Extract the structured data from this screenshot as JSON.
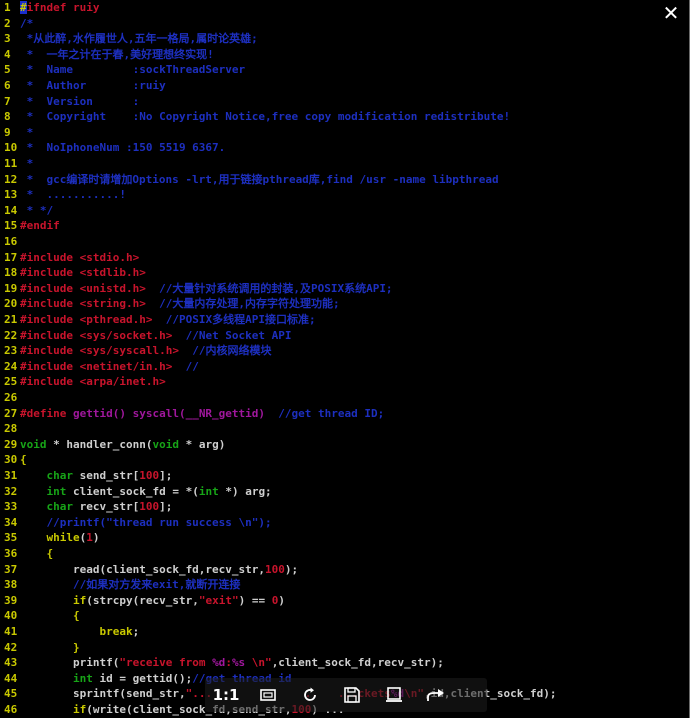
{
  "viewer": {
    "close_glyph": "✕",
    "toolbar": {
      "actual_size_label": "1:1",
      "buttons": [
        "actual-size",
        "fit-window",
        "rotate",
        "save",
        "download",
        "share"
      ]
    }
  },
  "code": {
    "lines": [
      {
        "n": "1",
        "spans": [
          [
            "cursor",
            "#"
          ],
          [
            "c-pre",
            "ifndef ruiy"
          ]
        ]
      },
      {
        "n": "2",
        "spans": [
          [
            "c-cmt",
            "/*"
          ]
        ]
      },
      {
        "n": "3",
        "spans": [
          [
            "c-cmt",
            " *从此醉,水作履世人,五年一格局,属时论英雄;"
          ]
        ]
      },
      {
        "n": "4",
        "spans": [
          [
            "c-cmt",
            " *  一年之计在于春,美好理想终实现!"
          ]
        ]
      },
      {
        "n": "5",
        "spans": [
          [
            "c-cmt",
            " *  Name         :sockThreadServer"
          ]
        ]
      },
      {
        "n": "6",
        "spans": [
          [
            "c-cmt",
            " *  Author       :ruiy"
          ]
        ]
      },
      {
        "n": "7",
        "spans": [
          [
            "c-cmt",
            " *  Version      :"
          ]
        ]
      },
      {
        "n": "8",
        "spans": [
          [
            "c-cmt",
            " *  Copyright    :No Copyright Notice,free copy modification redistribute!"
          ]
        ]
      },
      {
        "n": "9",
        "spans": [
          [
            "c-cmt",
            " *"
          ]
        ]
      },
      {
        "n": "10",
        "spans": [
          [
            "c-cmt",
            " *  NoIphoneNum :150 5519 6367."
          ]
        ]
      },
      {
        "n": "11",
        "spans": [
          [
            "c-cmt",
            " *"
          ]
        ]
      },
      {
        "n": "12",
        "spans": [
          [
            "c-cmt",
            " *  gcc编译时请增加Options -lrt,用于链接pthread库,find /usr -name libpthread"
          ]
        ]
      },
      {
        "n": "13",
        "spans": [
          [
            "c-cmt",
            " *  ...........!"
          ]
        ]
      },
      {
        "n": "14",
        "spans": [
          [
            "c-cmt",
            " * */"
          ]
        ]
      },
      {
        "n": "15",
        "spans": [
          [
            "c-pre",
            "#endif"
          ]
        ]
      },
      {
        "n": "16",
        "spans": []
      },
      {
        "n": "17",
        "spans": [
          [
            "c-pre",
            "#include "
          ],
          [
            "c-inc",
            "<stdio.h>"
          ]
        ]
      },
      {
        "n": "18",
        "spans": [
          [
            "c-pre",
            "#include "
          ],
          [
            "c-inc",
            "<stdlib.h>"
          ]
        ]
      },
      {
        "n": "19",
        "spans": [
          [
            "c-pre",
            "#include "
          ],
          [
            "c-inc",
            "<unistd.h>"
          ],
          [
            "c-cmt",
            "  //大量针对系统调用的封装,及POSIX系统API;"
          ]
        ]
      },
      {
        "n": "20",
        "spans": [
          [
            "c-pre",
            "#include "
          ],
          [
            "c-inc",
            "<string.h>"
          ],
          [
            "c-cmt",
            "  //大量内存处理,内存字符处理功能;"
          ]
        ]
      },
      {
        "n": "21",
        "spans": [
          [
            "c-pre",
            "#include "
          ],
          [
            "c-inc",
            "<pthread.h>"
          ],
          [
            "c-cmt",
            "  //POSIX多线程API接口标准;"
          ]
        ]
      },
      {
        "n": "22",
        "spans": [
          [
            "c-pre",
            "#include "
          ],
          [
            "c-inc",
            "<sys/socket.h>"
          ],
          [
            "c-cmt",
            "  //Net Socket API"
          ]
        ]
      },
      {
        "n": "23",
        "spans": [
          [
            "c-pre",
            "#include "
          ],
          [
            "c-inc",
            "<sys/syscall.h>"
          ],
          [
            "c-cmt",
            "  //内核网络模块"
          ]
        ]
      },
      {
        "n": "24",
        "spans": [
          [
            "c-pre",
            "#include "
          ],
          [
            "c-inc",
            "<netinet/in.h>"
          ],
          [
            "c-cmt",
            "  //"
          ]
        ]
      },
      {
        "n": "25",
        "spans": [
          [
            "c-pre",
            "#include "
          ],
          [
            "c-inc",
            "<arpa/inet.h>"
          ]
        ]
      },
      {
        "n": "26",
        "spans": []
      },
      {
        "n": "27",
        "spans": [
          [
            "c-pre",
            "#define "
          ],
          [
            "c-def",
            "gettid() syscall(__NR_gettid)"
          ],
          [
            "c-cmt",
            "  //get thread ID;"
          ]
        ]
      },
      {
        "n": "28",
        "spans": []
      },
      {
        "n": "29",
        "spans": [
          [
            "c-type",
            "void"
          ],
          [
            "c-txt",
            " * handler_conn("
          ],
          [
            "c-type",
            "void"
          ],
          [
            "c-txt",
            " * arg)"
          ]
        ]
      },
      {
        "n": "30",
        "spans": [
          [
            "c-kw",
            "{"
          ]
        ]
      },
      {
        "n": "31",
        "spans": [
          [
            "c-txt",
            "    "
          ],
          [
            "c-type",
            "char"
          ],
          [
            "c-txt",
            " send_str["
          ],
          [
            "c-num",
            "100"
          ],
          [
            "c-txt",
            "];"
          ]
        ]
      },
      {
        "n": "32",
        "spans": [
          [
            "c-txt",
            "    "
          ],
          [
            "c-type",
            "int"
          ],
          [
            "c-txt",
            " client_sock_fd = *("
          ],
          [
            "c-type",
            "int"
          ],
          [
            "c-txt",
            " *) arg;"
          ]
        ]
      },
      {
        "n": "33",
        "spans": [
          [
            "c-txt",
            "    "
          ],
          [
            "c-type",
            "char"
          ],
          [
            "c-txt",
            " recv_str["
          ],
          [
            "c-num",
            "100"
          ],
          [
            "c-txt",
            "];"
          ]
        ]
      },
      {
        "n": "34",
        "spans": [
          [
            "c-cmt",
            "    //printf(\"thread run success \\n\");"
          ]
        ]
      },
      {
        "n": "35",
        "spans": [
          [
            "c-txt",
            "    "
          ],
          [
            "c-kw",
            "while"
          ],
          [
            "c-txt",
            "("
          ],
          [
            "c-num",
            "1"
          ],
          [
            "c-txt",
            ")"
          ]
        ]
      },
      {
        "n": "36",
        "spans": [
          [
            "c-txt",
            "    "
          ],
          [
            "c-kw",
            "{"
          ]
        ]
      },
      {
        "n": "37",
        "spans": [
          [
            "c-txt",
            "        read(client_sock_fd,recv_str,"
          ],
          [
            "c-num",
            "100"
          ],
          [
            "c-txt",
            ");"
          ]
        ]
      },
      {
        "n": "38",
        "spans": [
          [
            "c-cmt",
            "        //如果对方发来exit,就断开连接"
          ]
        ]
      },
      {
        "n": "39",
        "spans": [
          [
            "c-txt",
            "        "
          ],
          [
            "c-kw",
            "if"
          ],
          [
            "c-txt",
            "(strcpy(recv_str,"
          ],
          [
            "c-str",
            "\"exit\""
          ],
          [
            "c-txt",
            ") == "
          ],
          [
            "c-num",
            "0"
          ],
          [
            "c-txt",
            ")"
          ]
        ]
      },
      {
        "n": "40",
        "spans": [
          [
            "c-txt",
            "        "
          ],
          [
            "c-kw",
            "{"
          ]
        ]
      },
      {
        "n": "41",
        "spans": [
          [
            "c-txt",
            "            "
          ],
          [
            "c-kw",
            "break"
          ],
          [
            "c-txt",
            ";"
          ]
        ]
      },
      {
        "n": "42",
        "spans": [
          [
            "c-txt",
            "        "
          ],
          [
            "c-kw",
            "}"
          ]
        ]
      },
      {
        "n": "43",
        "spans": [
          [
            "c-txt",
            "        printf("
          ],
          [
            "c-str",
            "\"receive from "
          ],
          [
            "c-fmt",
            "%d"
          ],
          [
            "c-str",
            ":"
          ],
          [
            "c-fmt",
            "%s"
          ],
          [
            "c-str",
            " \\n\""
          ],
          [
            "c-txt",
            ",client_sock_fd,recv_str);"
          ]
        ]
      },
      {
        "n": "44",
        "spans": [
          [
            "c-txt",
            "        "
          ],
          [
            "c-type",
            "int"
          ],
          [
            "c-txt",
            " id = gettid();"
          ],
          [
            "c-cmt",
            "//get thread id"
          ]
        ]
      },
      {
        "n": "45",
        "spans": [
          [
            "c-txt",
            "        sprintf(send_str,"
          ],
          [
            "c-str",
            "\"...              ..   ...ckets"
          ],
          [
            "c-fmt",
            "%d"
          ],
          [
            "c-str",
            "\\n\""
          ],
          [
            "c-txt",
            ",id,client_sock_fd);"
          ]
        ]
      },
      {
        "n": "46",
        "spans": [
          [
            "c-txt",
            "        "
          ],
          [
            "c-kw",
            "if"
          ],
          [
            "c-txt",
            "(write(client_sock_fd,send_str,"
          ],
          [
            "c-num",
            "100"
          ],
          [
            "c-txt",
            ") ..."
          ]
        ]
      }
    ]
  }
}
